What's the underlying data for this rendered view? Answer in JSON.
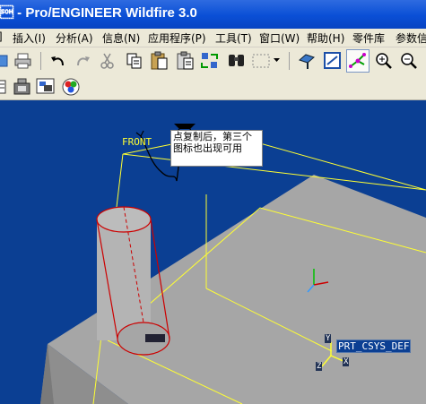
{
  "window": {
    "title": "\u0001 - Pro/ENGINEER Wildfire 3.0"
  },
  "menubar": {
    "items": [
      "插入(I)",
      "分析(A)",
      "信息(N)",
      "应用程序(P)",
      "工具(T)",
      "窗口(W)",
      "帮助(H)",
      "零件库",
      "参数信"
    ],
    "first_partial": "]"
  },
  "toolbar": {
    "icons": [
      "open-icon",
      "print-icon",
      "undo-icon",
      "redo-icon",
      "cut-icon",
      "copy-icon",
      "paste-icon",
      "paste-special-icon",
      "regenerate-icon",
      "find-icon",
      "select-box-icon",
      "dropdown-icon",
      "orient-icon",
      "repaint-icon",
      "spin-center-icon",
      "zoom-in-icon",
      "zoom-out-icon"
    ]
  },
  "viewport": {
    "front_label": "FRONT",
    "csys_label": "PRT_CSYS_DEF",
    "axis_x": "X",
    "axis_y": "Y",
    "axis_z": "Z",
    "annotation": {
      "line1": "点复制后，第三个",
      "line2": "图标也出现可用"
    },
    "colors": {
      "background": "#0b3f93",
      "plate": "#a6a6a6",
      "datum": "#ffff33",
      "cylinder_edge": "#cc0000"
    }
  }
}
